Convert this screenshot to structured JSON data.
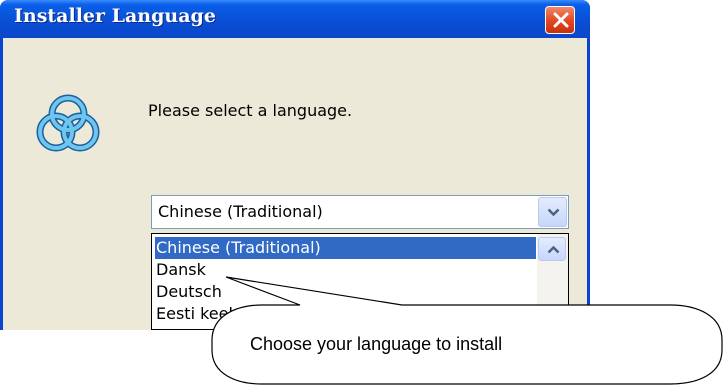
{
  "window": {
    "title": "Installer Language",
    "prompt": "Please select a language."
  },
  "language_select": {
    "selected_value": "Chinese (Traditional)",
    "options": [
      "Chinese (Traditional)",
      "Dansk",
      "Deutsch",
      "Eesti keel"
    ]
  },
  "callout": {
    "text": "Choose your language to install"
  },
  "icons": {
    "close": "close-icon",
    "app": "installer-logo-icon",
    "dropdown_arrow": "chevron-down-icon",
    "scroll_up": "chevron-up-icon"
  },
  "colors": {
    "titlebar": "#0a4fd6",
    "close_button": "#e2451f",
    "dialog_background": "#ece9d8",
    "selection": "#316ac5",
    "logo": "#2a8fd0"
  }
}
